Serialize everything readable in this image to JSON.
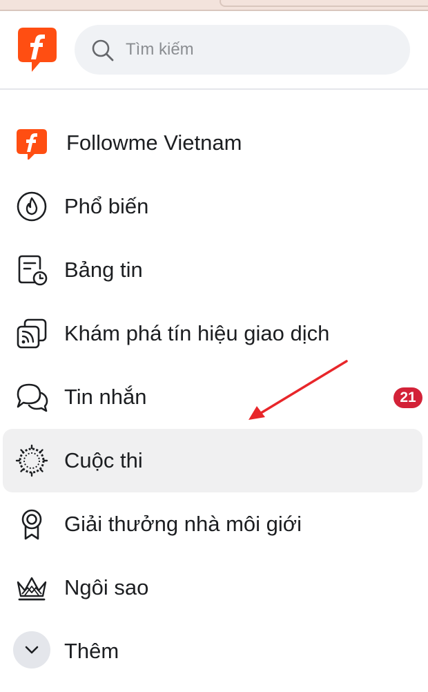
{
  "search": {
    "placeholder": "Tìm kiếm"
  },
  "brand_color": "#ff4e12",
  "nav": {
    "items": [
      {
        "label": "Followme Vietnam",
        "icon": "followme-logo-icon"
      },
      {
        "label": "Phổ biến",
        "icon": "flame-icon"
      },
      {
        "label": "Bảng tin",
        "icon": "feed-clock-icon"
      },
      {
        "label": "Khám phá tín hiệu giao dịch",
        "icon": "signal-cards-icon"
      },
      {
        "label": "Tin nhắn",
        "icon": "chat-bubbles-icon",
        "badge": "21"
      },
      {
        "label": "Cuộc thi",
        "icon": "contest-burst-icon",
        "active": true
      },
      {
        "label": "Giải thưởng nhà môi giới",
        "icon": "award-ribbon-icon"
      },
      {
        "label": "Ngôi sao",
        "icon": "crown-icon"
      },
      {
        "label": "Thêm",
        "icon": "chevron-down-icon"
      }
    ]
  },
  "annotation": {
    "arrow_color": "#e8262a"
  }
}
